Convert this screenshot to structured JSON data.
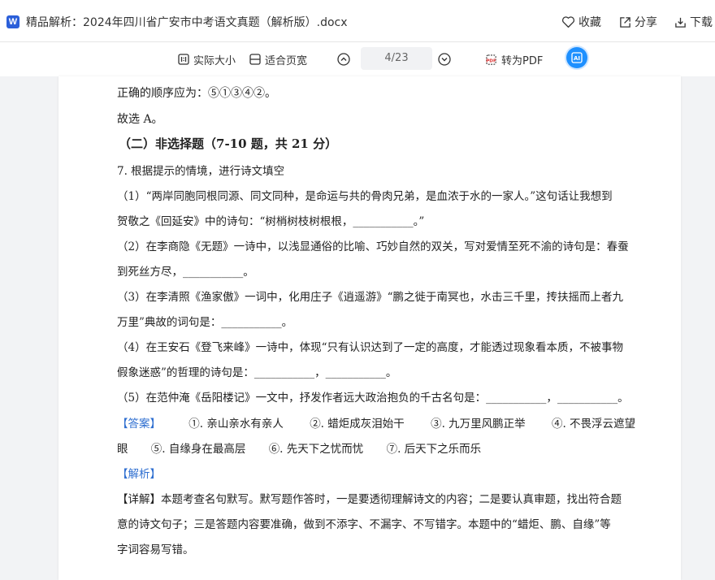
{
  "window": {
    "title": "精品解析：2024年四川省广安市中考语文真题（解析版）.docx",
    "app_icon_letter": "W",
    "actions": {
      "favorite": "收藏",
      "share": "分享",
      "download": "下载"
    }
  },
  "toolbar": {
    "actual_size": "实际大小",
    "fit_width": "适合页宽",
    "page_indicator": "4/23",
    "to_pdf": "转为PDF"
  },
  "document": {
    "lines": {
      "l1": "正确的顺序应为：⑤①③④②。",
      "l2": "故选 A。",
      "section_heading": "（二）非选择题（7-10 题，共 21 分）",
      "q7": "7. 根据提示的情境，进行诗文填空",
      "q7_1a": "（1）“两岸同胞同根同源、同文同种，是命运与共的骨肉兄弟，是血浓于水的一家人。”这句话让我想到",
      "q7_1b": "贺敬之《回延安》中的诗句：“树梢树枝树根根，___________。”",
      "q7_2a": "（2）在李商隐《无题》一诗中，以浅显通俗的比喻、巧妙自然的双关，写对爱情至死不渝的诗句是：春蚕",
      "q7_2b": "到死丝方尽，___________。",
      "q7_3a": "（3）在李清照《渔家傲》一词中，化用庄子《逍遥游》“鹏之徙于南冥也，水击三千里，抟扶摇而上者九",
      "q7_3b": "万里”典故的词句是：___________。",
      "q7_4a": "（4）在王安石《登飞来峰》一诗中，体现“只有认识达到了一定的高度，才能透过现象看本质，不被事物",
      "q7_4b": "假象迷惑”的哲理的诗句是：___________，___________。",
      "q7_5": "（5）在范仲淹《岳阳楼记》一文中，抒发作者远大政治抱负的千古名句是：___________，___________。",
      "answer_label": "【答案】",
      "ans1": "①. 亲山亲水有亲人",
      "ans2": "②. 蜡炬成灰泪始干",
      "ans3": "③. 九万里风鹏正举",
      "ans4a": "④. 不畏浮云遮望",
      "ans4b": "眼",
      "ans5": "⑤. 自缘身在最高层",
      "ans6": "⑥. 先天下之忧而忧",
      "ans7": "⑦. 后天下之乐而乐",
      "analysis_label": "【解析】",
      "detail_a": "【详解】本题考查名句默写。默写题作答时，一是要透彻理解诗文的内容；二是要认真审题，找出符合题",
      "detail_b": "意的诗文句子；三是答题内容要准确，做到不添字、不漏字、不写错字。本题中的“蜡炬、鹏、自缘”等",
      "detail_c": "字词容易写错。"
    }
  },
  "colors": {
    "accent": "#2f6fd0",
    "ai_button": "#1e90ff",
    "app_icon": "#2b5fd9"
  }
}
